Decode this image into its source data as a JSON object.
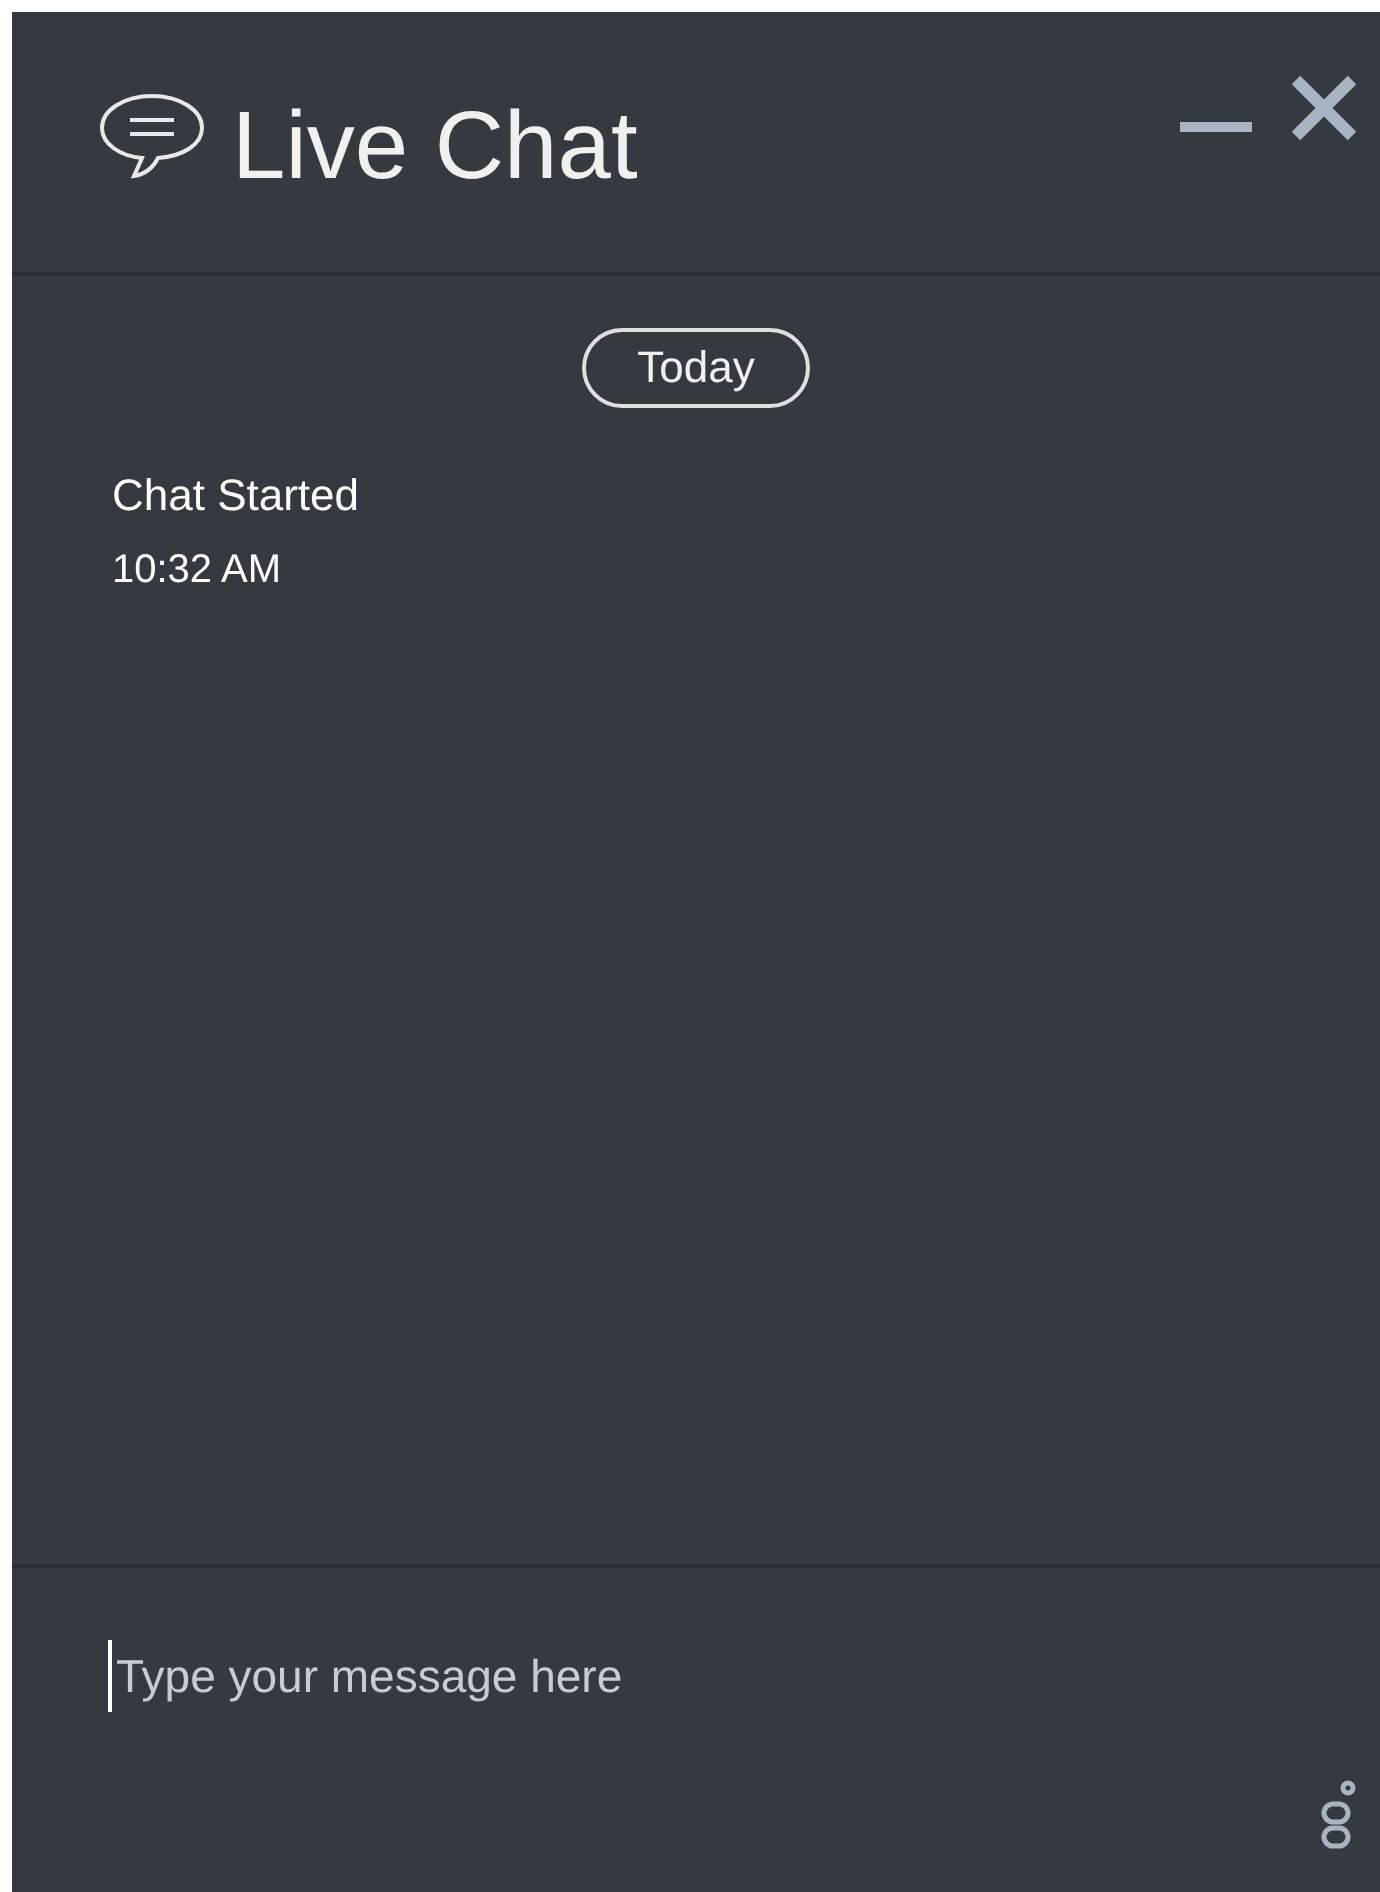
{
  "window": {
    "title": "Live Chat"
  },
  "date_divider": "Today",
  "events": [
    {
      "text": "Chat Started",
      "time": "10:32 AM"
    }
  ],
  "composer": {
    "placeholder": "Type your message here"
  }
}
